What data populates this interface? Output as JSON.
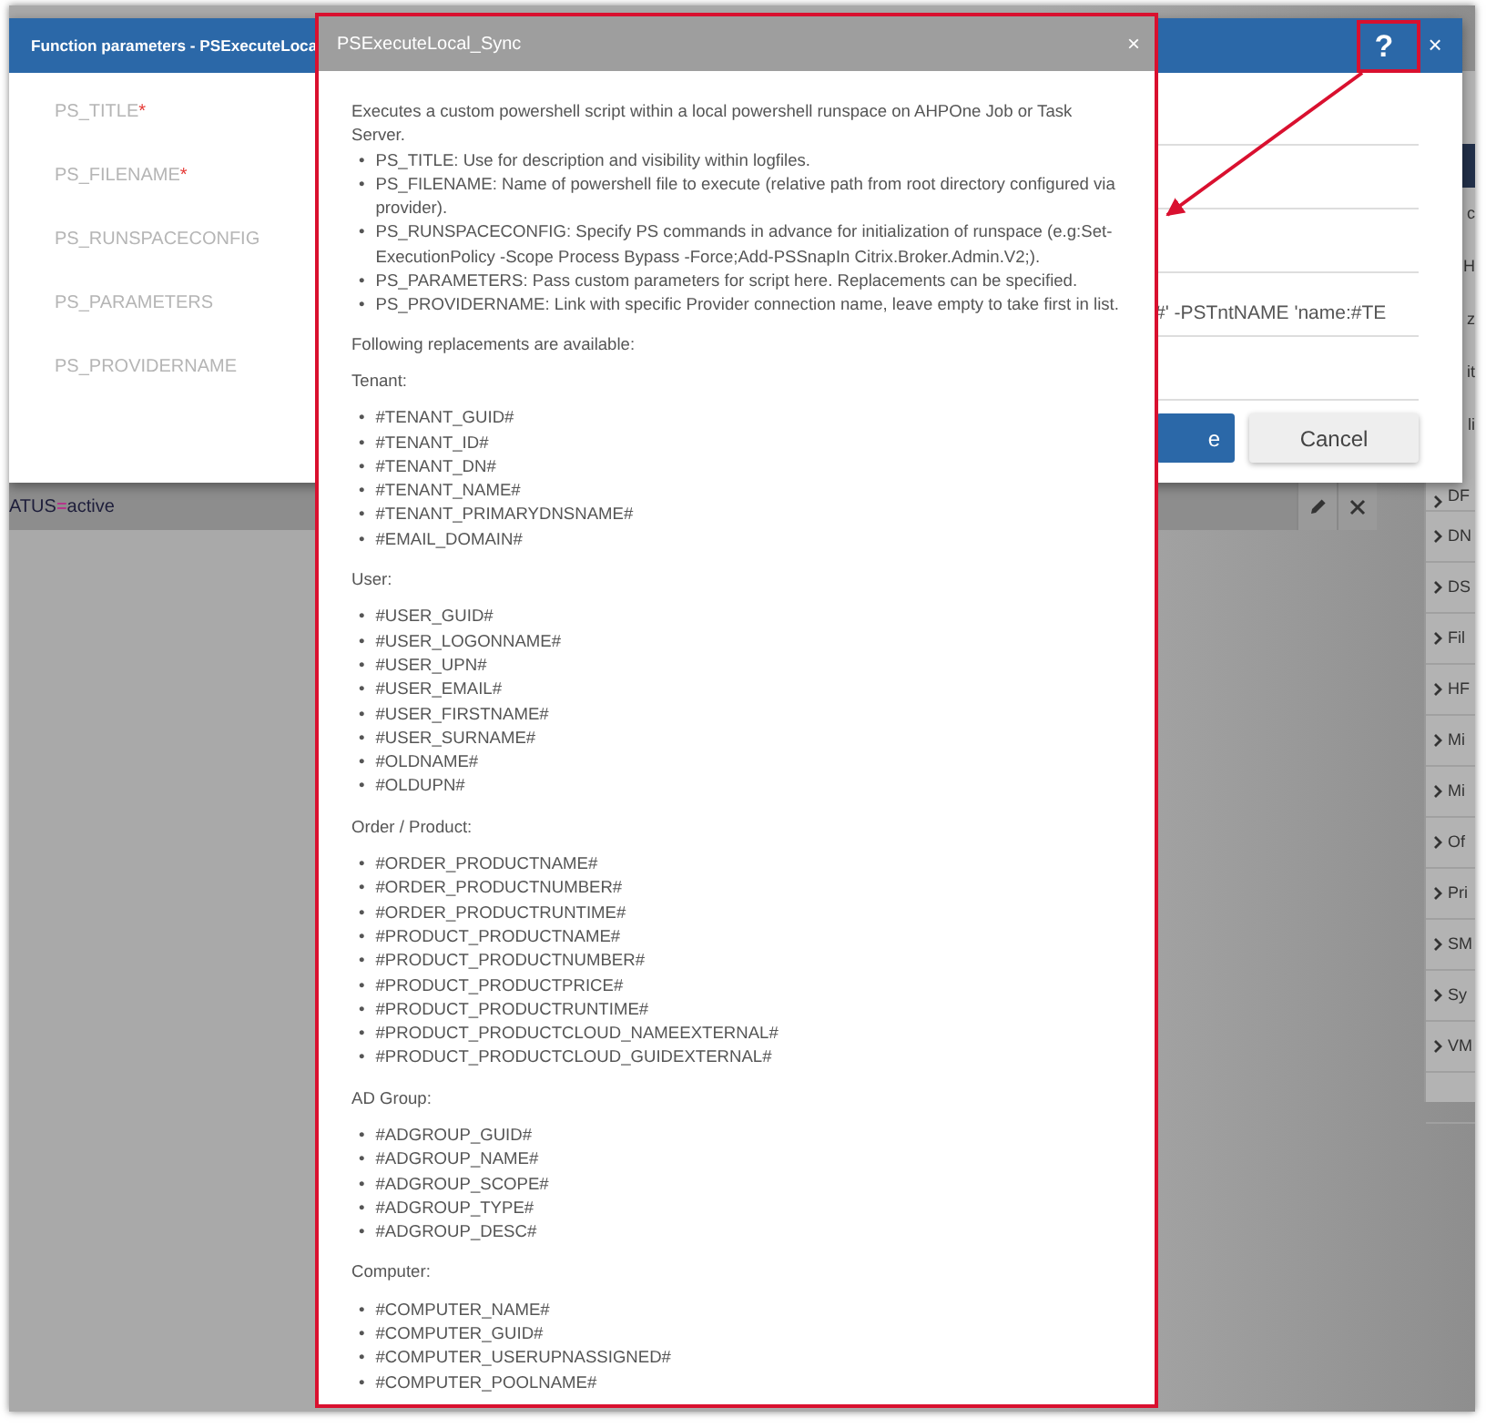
{
  "app": {
    "filter": {
      "field": "ATUS",
      "operator": "=",
      "value": "active"
    },
    "side_panel": {
      "cut_items": [
        "c",
        "H",
        "z",
        "it",
        "li"
      ],
      "items": [
        "DF",
        "DN",
        "DS",
        "Fil",
        "HF",
        "Mi",
        "Mi",
        "Of",
        "Pri",
        "SM",
        "Sy",
        "VM"
      ]
    }
  },
  "function_dialog": {
    "title": "Function parameters - PSExecuteLoca",
    "help_label": "?",
    "close_label": "×",
    "required_mark": "*",
    "fields": [
      {
        "label": "PS_TITLE",
        "required": true
      },
      {
        "label": "PS_FILENAME",
        "required": true
      },
      {
        "label": "PS_RUNSPACECONFIG",
        "required": false
      },
      {
        "label": "PS_PARAMETERS",
        "required": false,
        "value": "#' -PSTntNAME 'name:#TE"
      },
      {
        "label": "PS_PROVIDERNAME",
        "required": false
      }
    ],
    "buttons": [
      {
        "label": "e",
        "kind": "primary"
      },
      {
        "label": "Cancel",
        "kind": "secondary"
      }
    ]
  },
  "help_dialog": {
    "title": "PSExecuteLocal_Sync",
    "close_label": "×",
    "bullet": "•",
    "intro": "Executes a custom powershell script within a local powershell runspace on AHPOne Job or Task Server.",
    "params": [
      "PS_TITLE: Use for description and visibility within logfiles.",
      "PS_FILENAME: Name of powershell file to execute (relative path from root directory configured via provider).",
      "PS_RUNSPACECONFIG: Specify PS commands in advance for initialization of runspace (e.g:Set-ExecutionPolicy -Scope Process Bypass -Force;Add-PSSnapIn Citrix.Broker.Admin.V2;).",
      "PS_PARAMETERS: Pass custom parameters for script here. Replacements can be specified.",
      "PS_PROVIDERNAME: Link with specific Provider connection name, leave empty to take first in list."
    ],
    "following": "Following replacements are available:",
    "groups": [
      {
        "heading": "Tenant:",
        "items": [
          "#TENANT_GUID#",
          "#TENANT_ID#",
          "#TENANT_DN#",
          "#TENANT_NAME#",
          "#TENANT_PRIMARYDNSNAME#",
          "#EMAIL_DOMAIN#"
        ]
      },
      {
        "heading": "User:",
        "items": [
          "#USER_GUID#",
          "#USER_LOGONNAME#",
          "#USER_UPN#",
          "#USER_EMAIL#",
          "#USER_FIRSTNAME#",
          "#USER_SURNAME#",
          "#OLDNAME#",
          "#OLDUPN#"
        ]
      },
      {
        "heading": "Order / Product:",
        "items": [
          "#ORDER_PRODUCTNAME#",
          "#ORDER_PRODUCTNUMBER#",
          "#ORDER_PRODUCTRUNTIME#",
          "#PRODUCT_PRODUCTNAME#",
          "#PRODUCT_PRODUCTNUMBER#",
          "#PRODUCT_PRODUCTPRICE#",
          "#PRODUCT_PRODUCTRUNTIME#",
          "#PRODUCT_PRODUCTCLOUD_NAMEEXTERNAL#",
          "#PRODUCT_PRODUCTCLOUD_GUIDEXTERNAL#"
        ]
      },
      {
        "heading": "AD Group:",
        "items": [
          "#ADGROUP_GUID#",
          "#ADGROUP_NAME#",
          "#ADGROUP_SCOPE#",
          "#ADGROUP_TYPE#",
          "#ADGROUP_DESC#"
        ]
      },
      {
        "heading": "Computer:",
        "items": [
          "#COMPUTER_NAME#",
          "#COMPUTER_GUID#",
          "#COMPUTER_USERUPNASSIGNED#",
          "#COMPUTER_POOLNAME#"
        ]
      }
    ]
  }
}
